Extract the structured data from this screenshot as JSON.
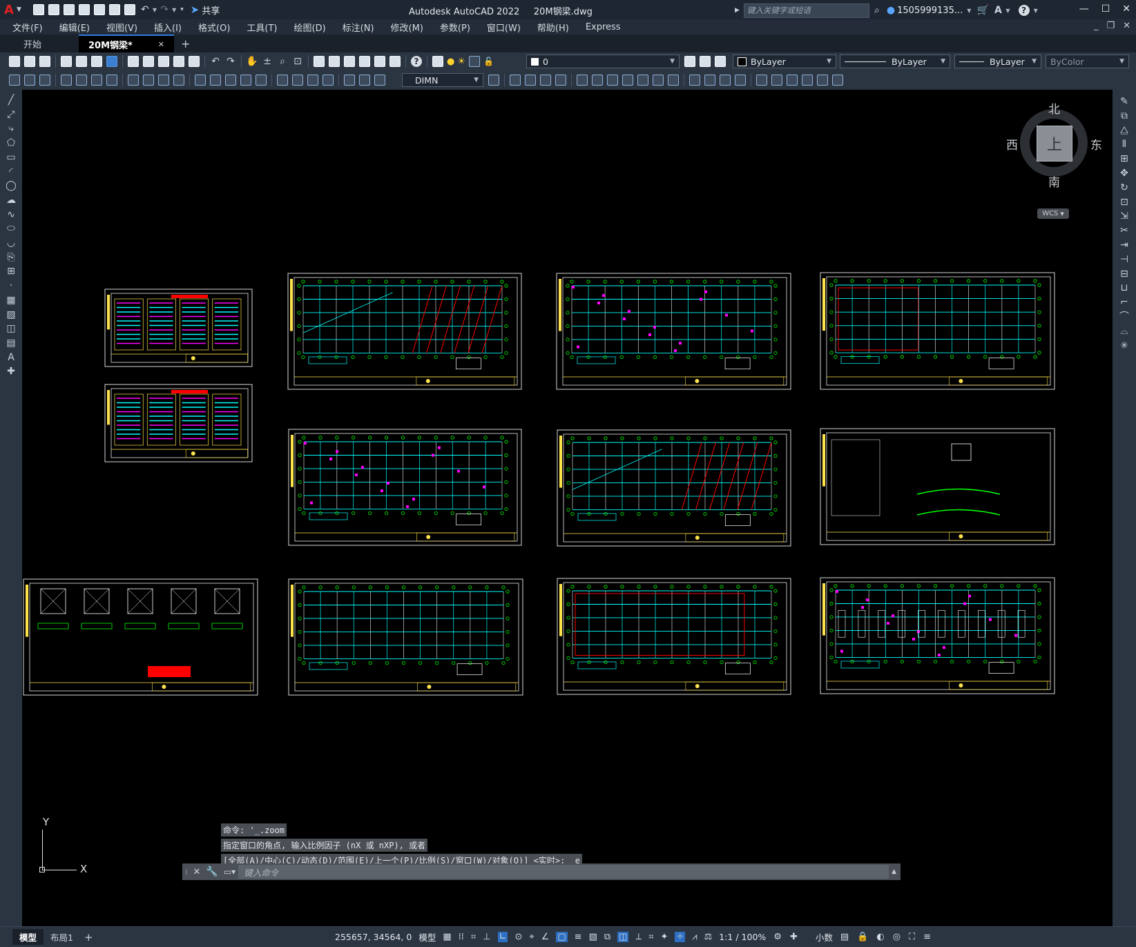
{
  "titlebar": {
    "app_logo": "A",
    "title": "Autodesk AutoCAD 2022     20M钢梁.dwg",
    "share_label": "共享",
    "search_placeholder": "键入关键字或短语",
    "user": "1505999135...",
    "minimize": "—",
    "restore": "☐",
    "close": "✕"
  },
  "menubar": {
    "items": [
      "文件(F)",
      "编辑(E)",
      "视图(V)",
      "插入(I)",
      "格式(O)",
      "工具(T)",
      "绘图(D)",
      "标注(N)",
      "修改(M)",
      "参数(P)",
      "窗口(W)",
      "帮助(H)",
      "Express"
    ]
  },
  "tabs": {
    "start": "开始",
    "drawing": "20M钢梁*",
    "close": "✕",
    "add": "+"
  },
  "toolbar1": {
    "layer_value": "0",
    "color_value": "ByLayer",
    "linetype_value": "ByLayer",
    "lineweight_value": "ByLayer",
    "plotstyle_value": "ByColor"
  },
  "toolbar2": {
    "dimstyle_value": "DIMN"
  },
  "viewcube": {
    "north": "北",
    "south": "南",
    "east": "东",
    "west": "西",
    "top": "上",
    "wcs": "WCS"
  },
  "ucs": {
    "x": "X",
    "y": "Y"
  },
  "command": {
    "history": [
      "命令: '_.zoom",
      "指定窗口的角点, 输入比例因子 (nX 或 nXP), 或者",
      "[全部(A)/中心(C)/动态(D)/范围(E)/上一个(P)/比例(S)/窗口(W)/对象(O)] <实时>: _e"
    ],
    "placeholder": "键入命令"
  },
  "statusbar": {
    "tab_model": "模型",
    "tab_layout": "布局1",
    "add": "+",
    "coords": "255657, 34564, 0",
    "mode": "模型",
    "scale": "1:1 / 100%",
    "units": "小数"
  },
  "colors": {
    "accent": "#2d7be0",
    "cyan": "#00ffff",
    "green": "#00ff00",
    "red": "#ff0000",
    "yellow": "#ffe34a",
    "magenta": "#ff00ff"
  }
}
